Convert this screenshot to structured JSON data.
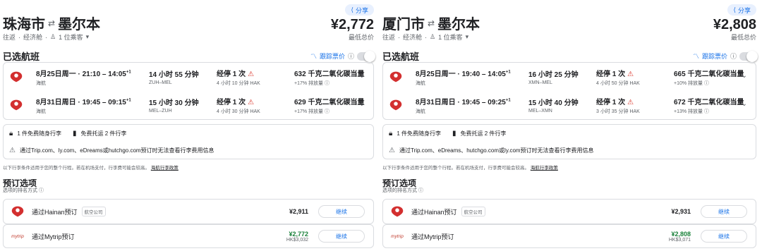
{
  "panels": [
    {
      "share": "分享",
      "route": {
        "from": "珠海市",
        "to": "墨尔本"
      },
      "price": "¥2,772",
      "meta": {
        "trip": "往返",
        "cabin": "经济舱",
        "passengers": "1 位乘客"
      },
      "price_note": "",
      "selected_title": "已选航班",
      "track_label": "跟踪票价",
      "flights": [
        {
          "date": "8月25日周一",
          "times": "21:10 – 14:05",
          "sup": "+1",
          "airline": "海航",
          "duration": "14 小时 55 分钟",
          "airports": "ZUH–MEL",
          "stops": "经停 1 次",
          "stop_detail": "4 小时 10 分钟 HAK",
          "co2": "632 千克二氧化碳当量",
          "co2_sub": "+17% 排放量"
        },
        {
          "date": "8月31日周日",
          "times": "19:45 – 09:15",
          "sup": "+1",
          "airline": "海航",
          "duration": "15 小时 30 分钟",
          "airports": "MEL–ZUH",
          "stops": "经停 1 次",
          "stop_detail": "4 小时 30 分钟 HAK",
          "co2": "629 千克二氧化碳当量",
          "co2_sub": "+17% 排放量"
        }
      ],
      "bags": {
        "carry": "1 件免费随身行李",
        "checked": "免费托运 2 件行李",
        "warning": "通过Trip.com、ly.com、eDreams或hutchgo.com预订时无法查看行李费用信息"
      },
      "notice": {
        "text": "以下行李条件适用于您的整个行程。若在机场支付，行李费可能会较高。",
        "link": "海航行李政策"
      },
      "booking": {
        "title": "预订选项",
        "subtitle": "选项的排名方式",
        "options": [
          {
            "name": "通过Hainan预订",
            "tag": "航空公司",
            "price": "¥2,911",
            "hk": "",
            "button": "继续"
          },
          {
            "name": "通过Mytrip预订",
            "tag": "",
            "price": "¥2,772",
            "hk": "HK$3,032",
            "button": "继续",
            "logo": "mytrip"
          }
        ]
      }
    },
    {
      "share": "分享",
      "route": {
        "from": "厦门市",
        "to": "墨尔本"
      },
      "price": "¥2,808",
      "meta": {
        "trip": "往返",
        "cabin": "经济舱",
        "passengers": "1 位乘客"
      },
      "price_note": "最低总价",
      "selected_title": "已选航班",
      "track_label": "跟踪票价",
      "flights": [
        {
          "date": "8月25日周一",
          "times": "19:40 – 14:05",
          "sup": "+1",
          "airline": "海航",
          "duration": "16 小时 25 分钟",
          "airports": "XMN–MEL",
          "stops": "经停 1 次",
          "stop_detail": "4 小时 50 分钟 HAK",
          "co2": "665 千克二氧化碳当量",
          "co2_sub": "+10% 排放量"
        },
        {
          "date": "8月31日周日",
          "times": "19:45 – 09:25",
          "sup": "+1",
          "airline": "海航",
          "duration": "15 小时 40 分钟",
          "airports": "MEL–XMN",
          "stops": "经停 1 次",
          "stop_detail": "3 小时 35 分钟 HAK",
          "co2": "672 千克二氧化碳当量",
          "co2_sub": "+13% 排放量"
        }
      ],
      "bags": {
        "carry": "1 件免费随身行李",
        "checked": "免费托运 2 件行李",
        "warning": "通过Trip.com、eDreams、hutchgo.com或ly.com预订时无法查看行李费用信息"
      },
      "notice": {
        "text": "以下行李条件适用于您的整个行程。若在机场支付，行李费可能会较高。",
        "link": "海航行李政策"
      },
      "booking": {
        "title": "预订选项",
        "subtitle": "选项的排名方式",
        "options": [
          {
            "name": "通过Hainan预订",
            "tag": "航空公司",
            "price": "¥2,931",
            "hk": "",
            "button": "继续"
          },
          {
            "name": "通过Mytrip预订",
            "tag": "",
            "price": "¥2,808",
            "hk": "HK$3,071",
            "button": "继续",
            "logo": "mytrip"
          }
        ]
      }
    }
  ],
  "left_price_note": "最低总价"
}
